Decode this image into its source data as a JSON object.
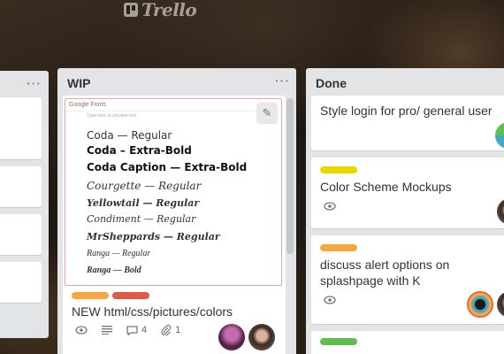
{
  "app": {
    "logo_text": "Trello"
  },
  "lists": {
    "wip": {
      "title": "WIP",
      "menu": "···",
      "cover": {
        "header": "Google Fonts",
        "placeholder": "Type here to preview text",
        "fonts": [
          "Coda — Regular",
          "Coda – Extra-Bold",
          "Coda Caption — Extra-Bold",
          "Courgette — Regular",
          "Yellowtail — Regular",
          "Condiment — Regular",
          "MrSheppards — Regular",
          "Ranga — Regular",
          "Ranga — Bold"
        ]
      },
      "card": {
        "title": "NEW html/css/pictures/colors",
        "labels": [
          "#f5a742",
          "#e05a48"
        ],
        "badge_comments": "4",
        "badge_attachments": "1"
      }
    },
    "done": {
      "title": "Done",
      "menu": "···",
      "cards": [
        {
          "title": "Style login for pro/ general user"
        },
        {
          "title": "Color Scheme Mockups",
          "label": "#e8d800"
        },
        {
          "title": "discuss alert options on splashpage with K",
          "label": "#f5a742"
        },
        {
          "label": "#61bd4f"
        }
      ]
    },
    "left": {
      "menu": "···"
    }
  },
  "colors": {
    "list_bg": "#e2e4e6",
    "card_bg": "#ffffff"
  }
}
